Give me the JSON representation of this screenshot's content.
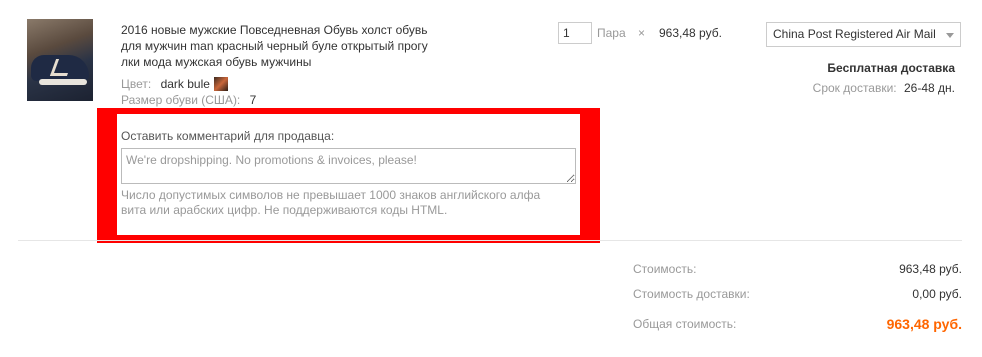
{
  "item": {
    "title": "2016 новые мужские Повседневная Обувь холст обувь для мужчин man красный черный буле открытый прогулки мода мужская обувь мужчины",
    "color_label": "Цвет:",
    "color_value": "dark bule",
    "size_label": "Размер обуви (США):",
    "size_value": "7",
    "quantity": "1",
    "unit": "Пара",
    "times": "×",
    "price": "963,48 руб."
  },
  "shipping": {
    "method": "China Post Registered Air Mail",
    "free_shipping": "Бесплатная доставка",
    "delivery_label": "Срок доставки:",
    "delivery_value": "26-48 дн."
  },
  "comment": {
    "label": "Оставить комментарий для продавца:",
    "placeholder": "We're dropshipping. No promotions & invoices, please!",
    "hint": "Число допустимых символов не превышает 1000 знаков английского алфавита или арабских цифр. Не поддерживаются коды HTML."
  },
  "summary": {
    "cost_label": "Стоимость:",
    "cost_value": "963,48 руб.",
    "shipping_label": "Стоимость доставки:",
    "shipping_value": "0,00 руб.",
    "total_label": "Общая стоимость:",
    "total_value": "963,48 руб."
  },
  "colors": {
    "highlight_frame": "#ff0000",
    "total_accent": "#ff6600"
  }
}
